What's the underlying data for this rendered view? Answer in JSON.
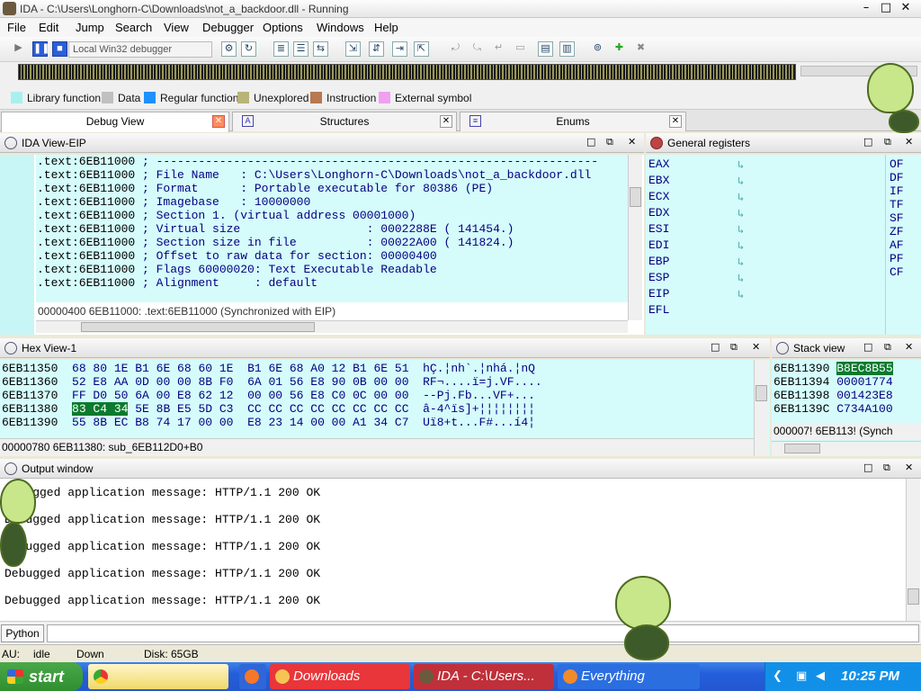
{
  "window": {
    "title": "IDA - C:\\Users\\Longhorn-C\\Downloads\\not_a_backdoor.dll - Running"
  },
  "menu": [
    "File",
    "Edit",
    "Jump",
    "Search",
    "View",
    "Debugger",
    "Options",
    "Windows",
    "Help"
  ],
  "toolbar": {
    "debugger_select": "Local Win32 debugger"
  },
  "legend": [
    {
      "label": "Library function",
      "color": "#a8f0f0"
    },
    {
      "label": "Data",
      "color": "#c0c0c0"
    },
    {
      "label": "Regular function",
      "color": "#1e90ff"
    },
    {
      "label": "Unexplored",
      "color": "#b8b478"
    },
    {
      "label": "Instruction",
      "color": "#b87850"
    },
    {
      "label": "External symbol",
      "color": "#f0a0f0"
    }
  ],
  "tabs": [
    {
      "label": "Debug View"
    },
    {
      "label": "Structures"
    },
    {
      "label": "Enums"
    }
  ],
  "ida_view": {
    "title": "IDA View-EIP",
    "lines": [
      [
        ".text:6EB11000",
        " ; ---------------------------------------------------------------"
      ],
      [
        ".text:6EB11000",
        " ; File Name   : C:\\Users\\Longhorn-C\\Downloads\\not_a_backdoor.dll"
      ],
      [
        ".text:6EB11000",
        " ; Format      : Portable executable for 80386 (PE)"
      ],
      [
        ".text:6EB11000",
        " ; Imagebase   : 10000000"
      ],
      [
        ".text:6EB11000",
        " ; Section 1. (virtual address 00001000)"
      ],
      [
        ".text:6EB11000",
        " ; Virtual size                  : 0002288E ( 141454.)"
      ],
      [
        ".text:6EB11000",
        " ; Section size in file          : 00022A00 ( 141824.)"
      ],
      [
        ".text:6EB11000",
        " ; Offset to raw data for section: 00000400"
      ],
      [
        ".text:6EB11000",
        " ; Flags 60000020: Text Executable Readable"
      ],
      [
        ".text:6EB11000",
        " ; Alignment     : default"
      ]
    ],
    "status": "00000400 6EB11000: .text:6EB11000 (Synchronized with EIP)"
  },
  "registers": {
    "title": "General registers",
    "names": [
      "EAX",
      "EBX",
      "ECX",
      "EDX",
      "ESI",
      "EDI",
      "EBP",
      "ESP",
      "EIP",
      "EFL"
    ],
    "flags": [
      "OF",
      "DF",
      "IF",
      "TF",
      "SF",
      "ZF",
      "AF",
      "PF",
      "CF"
    ]
  },
  "hex_view": {
    "title": "Hex View-1",
    "rows": [
      {
        "addr": "6EB11350",
        "bytes": "68 80 1E B1 6E 68 60 1E  B1 6E 68 A0 12 B1 6E 51",
        "ascii": "hÇ.¦nh`.¦nhá.¦nQ"
      },
      {
        "addr": "6EB11360",
        "bytes": "52 E8 AA 0D 00 00 8B F0  6A 01 56 E8 90 0B 00 00",
        "ascii": "RF¬....ï=j.VF...."
      },
      {
        "addr": "6EB11370",
        "bytes": "FF D0 50 6A 00 E8 62 12  00 00 56 E8 C0 0C 00 00",
        "ascii": "--Pj.Fb...VF+..."
      },
      {
        "addr": "6EB11380",
        "sel": "83 C4 34",
        "bytes": " 5E 8B E5 5D C3  CC CC CC CC CC CC CC CC",
        "ascii": "â-4^ïs]+¦¦¦¦¦¦¦¦"
      },
      {
        "addr": "6EB11390",
        "bytes": "55 8B EC B8 74 17 00 00  E8 23 14 00 00 A1 34 C7",
        "ascii": "Uï8+t...F#...í4¦"
      }
    ],
    "status": "00000780 6EB11380: sub_6EB112D0+B0"
  },
  "stack_view": {
    "title": "Stack view",
    "rows": [
      {
        "addr": "6EB11390",
        "val": "B8EC8B55",
        "sel": true
      },
      {
        "addr": "6EB11394",
        "val": "00001774"
      },
      {
        "addr": "6EB11398",
        "val": "001423E8"
      },
      {
        "addr": "6EB1139C",
        "val": "C734A100"
      }
    ],
    "status": "000007! 6EB113! (Synch"
  },
  "output": {
    "title": "Output window",
    "lines": [
      "Debugged application message: HTTP/1.1 200 OK",
      "Debugged application message: HTTP/1.1 200 OK",
      "Debugged application message: HTTP/1.1 200 OK",
      "Debugged application message: HTTP/1.1 200 OK",
      "Debugged application message: HTTP/1.1 200 OK"
    ],
    "python_button": "Python"
  },
  "status": {
    "au": "AU:",
    "state": "idle",
    "down": "Down",
    "disk": "Disk: 65GB"
  },
  "taskbar": {
    "start": "start",
    "items": [
      {
        "label": "Downloads",
        "color": "#e8363a",
        "icon": "#f6c453"
      },
      {
        "label": "IDA - C:\\Users...",
        "color": "#c0303a",
        "icon": "#6b5a3e"
      },
      {
        "label": "Everything",
        "color": "#2b6ee0",
        "icon": "#f08a2a"
      }
    ],
    "clock": "10:25 PM"
  }
}
